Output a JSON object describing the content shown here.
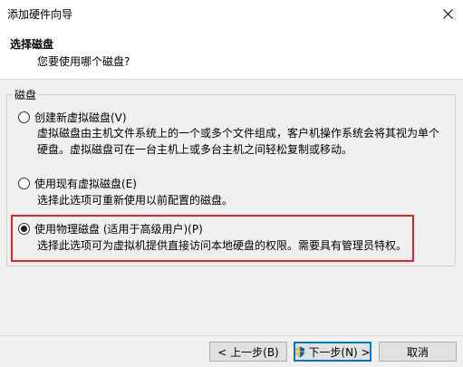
{
  "window": {
    "title": "添加硬件向导"
  },
  "header": {
    "title": "选择磁盘",
    "subtitle": "您要使用哪个磁盘?"
  },
  "group": {
    "label": "磁盘",
    "options": [
      {
        "label": "创建新虚拟磁盘(V)",
        "checked": false,
        "desc_lines": [
          "虚拟磁盘由主机文件系统上的一个或多个文件组成，客户机操作系统会将其视为单个",
          "硬盘。虚拟磁盘可在一台主机上或多台主机之间轻松复制或移动。"
        ]
      },
      {
        "label": "使用现有虚拟磁盘(E)",
        "checked": false,
        "desc_lines": [
          "选择此选项可重新使用以前配置的磁盘。"
        ]
      },
      {
        "label": "使用物理磁盘 (适用于高级用户)(P)",
        "checked": true,
        "desc_lines": [
          "选择此选项可为虚拟机提供直接访问本地硬盘的权限。需要具有管理员特权。"
        ]
      }
    ]
  },
  "highlight_color": "#e0262c",
  "buttons": {
    "back": "< 上一步(B)",
    "next": "下一步(N) >",
    "cancel": "取消"
  },
  "icons": {
    "close": "close-icon",
    "shield": "uac-shield-icon"
  }
}
